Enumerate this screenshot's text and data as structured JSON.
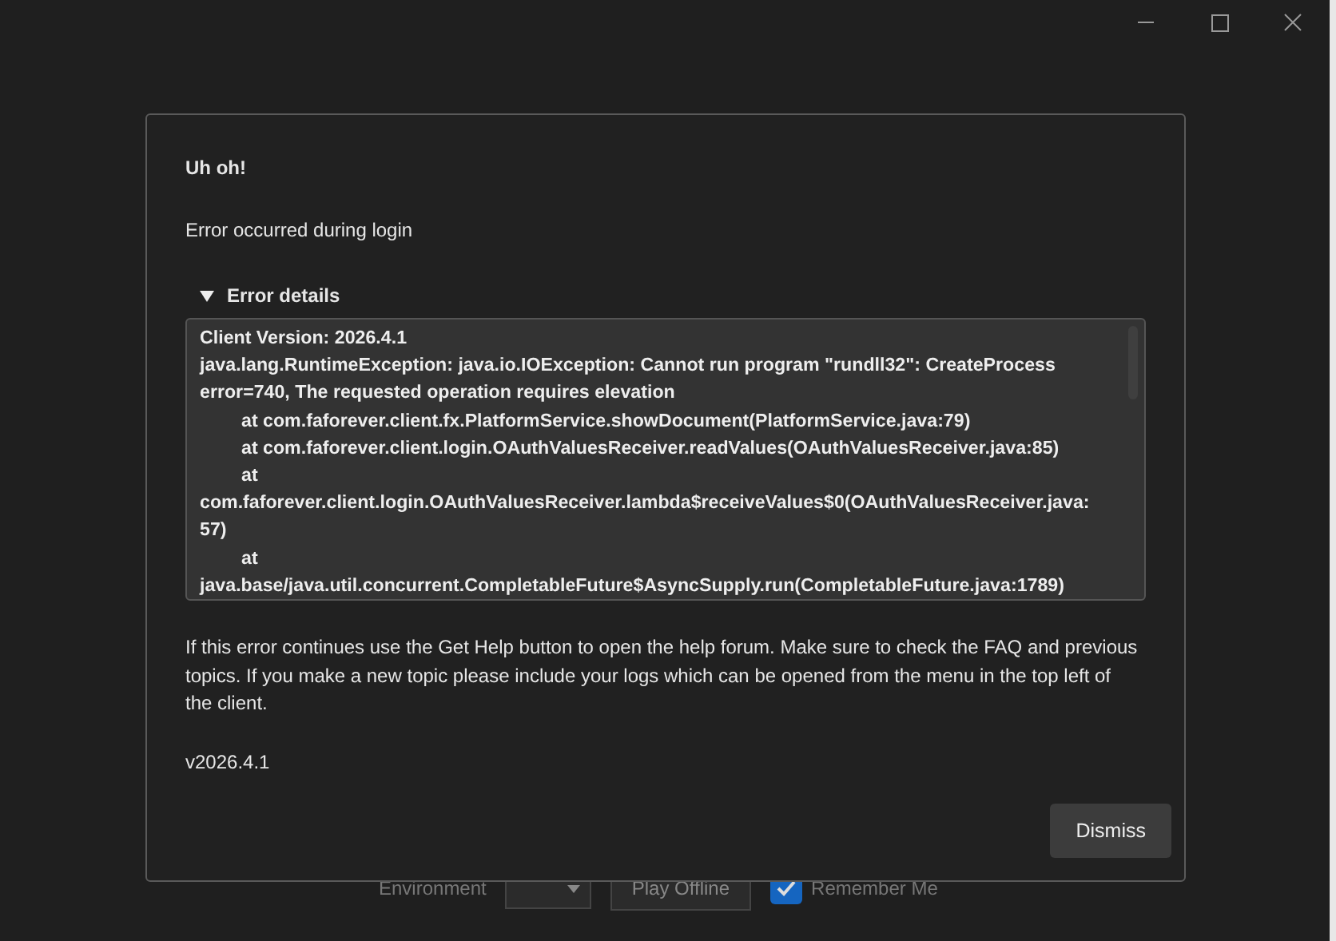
{
  "dialog": {
    "title": "Uh oh!",
    "message": "Error occurred during login",
    "details": {
      "label": "Error details",
      "expanded": true,
      "lines": [
        {
          "text": "Client Version: 2026.4.1",
          "indent": false
        },
        {
          "text": "java.lang.RuntimeException: java.io.IOException: Cannot run program \"rundll32\": CreateProcess",
          "indent": false
        },
        {
          "text": "error=740, The requested operation requires elevation",
          "indent": false
        },
        {
          "text": "at com.faforever.client.fx.PlatformService.showDocument(PlatformService.java:79)",
          "indent": true
        },
        {
          "text": "at com.faforever.client.login.OAuthValuesReceiver.readValues(OAuthValuesReceiver.java:85)",
          "indent": true
        },
        {
          "text": "at",
          "indent": true
        },
        {
          "text": "com.faforever.client.login.OAuthValuesReceiver.lambda$receiveValues$0(OAuthValuesReceiver.java:",
          "indent": false
        },
        {
          "text": "57)",
          "indent": false
        },
        {
          "text": "at",
          "indent": true
        },
        {
          "text": "java.base/java.util.concurrent.CompletableFuture$AsyncSupply.run(CompletableFuture.java:1789)",
          "indent": false
        }
      ]
    },
    "help": "If this error continues use the Get Help button to open the help forum. Make sure to check the FAQ and previous topics. If you make a new topic please include your logs which can be opened from the menu in the top left of the client.",
    "version": "v2026.4.1",
    "button": "Dismiss"
  },
  "login": {
    "environment_label": "Environment",
    "play_offline": "Play Offline",
    "remember_me": {
      "label": "Remember Me",
      "checked": true
    }
  }
}
